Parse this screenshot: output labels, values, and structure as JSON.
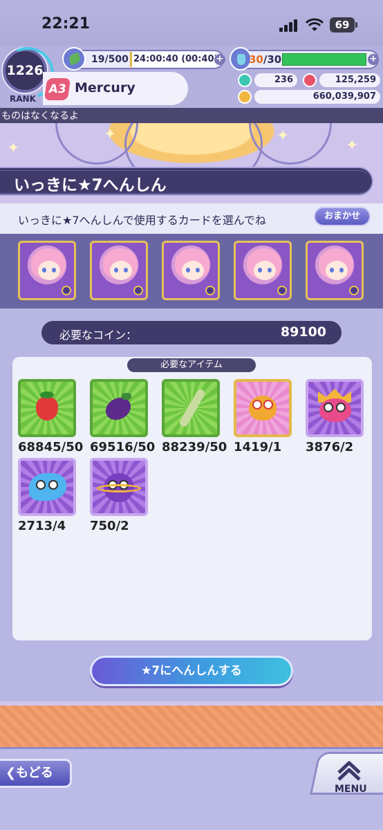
{
  "status_bar": {
    "time": "22:21",
    "battery": "69"
  },
  "header": {
    "rank_value": "1226",
    "rank_label": "RANK",
    "stamina": "19/500",
    "stamina_timer": "24:00:40 (00:40)",
    "bottle_current": "30",
    "bottle_max": "/30",
    "player_badge": "A3",
    "player_name": "Mercury",
    "gems": "236",
    "stones": "125,259",
    "coins": "660,039,907"
  },
  "marquee": "ものはなくなるよ",
  "page_title": "いっきに★7へんしん",
  "instruction": {
    "text": "いっきに★7へんしんで使用するカードを選んでね",
    "omakase_label": "おまかせ"
  },
  "cards": [
    {
      "name": "card-1"
    },
    {
      "name": "card-2"
    },
    {
      "name": "card-3"
    },
    {
      "name": "card-4"
    },
    {
      "name": "card-5"
    }
  ],
  "coin_requirement": {
    "label": "必要なコイン：",
    "value": "89100"
  },
  "items": {
    "header": "必要なアイテム",
    "list": [
      {
        "icon": "strawberry-icon",
        "count": "68845/50"
      },
      {
        "icon": "eggplant-icon",
        "count": "69516/50"
      },
      {
        "icon": "asparagus-icon",
        "count": "88239/50"
      },
      {
        "icon": "red-puyo-icon",
        "count": "1419/1"
      },
      {
        "icon": "crown-puyo-icon",
        "count": "3876/2"
      },
      {
        "icon": "blue-puyo-icon",
        "count": "2713/4"
      },
      {
        "icon": "purple-puyo-icon",
        "count": "750/2"
      }
    ]
  },
  "evolve_button": "★7にへんしんする",
  "footer": {
    "back_label": "もどる",
    "menu_label": "MENU"
  },
  "colors": {
    "background": "#b9b7e4",
    "title_bar": "#3f3a6a",
    "accent_green": "#34c35b",
    "accent_orange": "#e36a1c"
  }
}
